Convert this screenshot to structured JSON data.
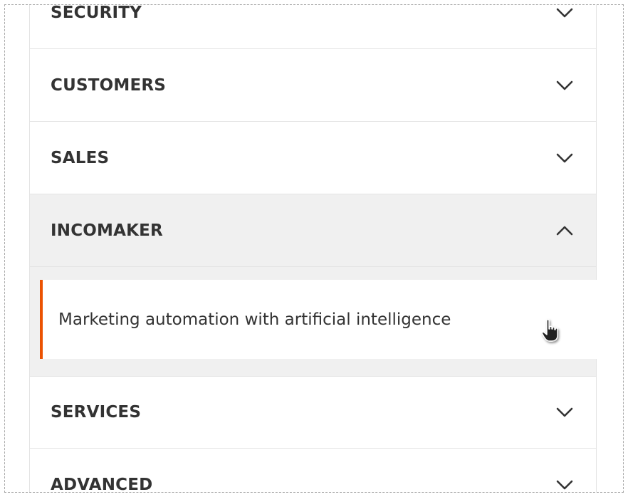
{
  "menu": {
    "sections": [
      {
        "key": "security",
        "label": "SECURITY",
        "expanded": false
      },
      {
        "key": "customers",
        "label": "CUSTOMERS",
        "expanded": false
      },
      {
        "key": "sales",
        "label": "SALES",
        "expanded": false
      },
      {
        "key": "incomaker",
        "label": "INCOMAKER",
        "expanded": true
      },
      {
        "key": "services",
        "label": "SERVICES",
        "expanded": false
      },
      {
        "key": "advanced",
        "label": "ADVANCED",
        "expanded": false
      }
    ],
    "incomaker_items": [
      {
        "label": "Marketing automation with artificial intelligence"
      }
    ]
  },
  "colors": {
    "accent": "#eb5202",
    "text": "#333333",
    "active_bg": "#f0f0f0",
    "border": "#e3e3e3"
  },
  "icons": {
    "collapsed": "chevron-down-icon",
    "expanded": "chevron-up-icon",
    "pointer": "hand-pointer-cursor"
  }
}
